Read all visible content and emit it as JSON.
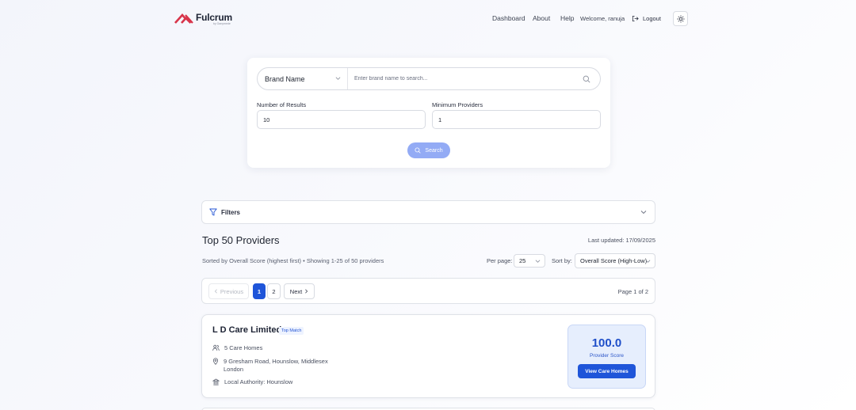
{
  "header": {
    "logo_name": "Fulcrum",
    "logo_sub": "by Ganymede",
    "nav": {
      "dashboard": "Dashboard",
      "about": "About",
      "help": "Help"
    },
    "welcome": "Welcome, ranuja",
    "logout": "Logout"
  },
  "search": {
    "brand_select": "Brand Name",
    "brand_placeholder": "Enter brand name to search...",
    "num_results_label": "Number of Results",
    "num_results_value": "10",
    "min_providers_label": "Minimum Providers",
    "min_providers_value": "1",
    "search_button": "Search"
  },
  "filters": {
    "label": "Filters"
  },
  "results": {
    "title": "Top 50 Providers",
    "last_updated": "Last updated: 17/09/2025",
    "sorted_text": "Sorted by Overall Score (highest first) • Showing 1-25 of 50 providers",
    "per_page_label": "Per page:",
    "per_page_value": "25",
    "sort_by_label": "Sort by:",
    "sort_by_value": "Overall Score (High-Low)"
  },
  "pagination": {
    "previous": "Previous",
    "pages": [
      "1",
      "2"
    ],
    "next": "Next",
    "page_info": "Page 1 of 2"
  },
  "providers": [
    {
      "name": "L D Care Limited",
      "badge": "Top Match",
      "care_homes": "5 Care Homes",
      "address_line1": "9 Gresham Road, Hounslow, Middlesex",
      "address_line2": "London",
      "local_authority": "Local Authority: Hounslow",
      "score": "100.0",
      "score_label": "Provider Score",
      "view_button": "View Care Homes"
    }
  ],
  "colors": {
    "primary": "#1f55d9",
    "search_button": "#93abf5",
    "logo_accent": "#d8344a",
    "score_bg": "#e6eefd"
  }
}
